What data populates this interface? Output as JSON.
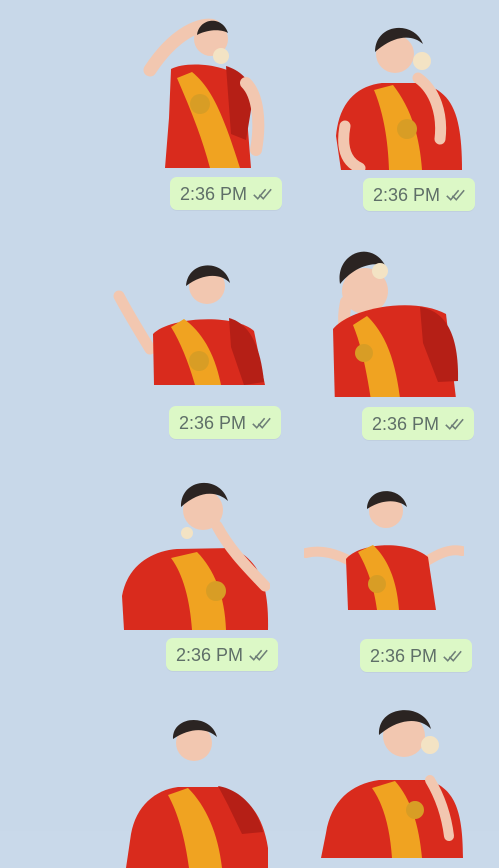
{
  "messages": [
    {
      "time": "2:36 PM",
      "sticker": "woman-hand-on-forehead-sticker",
      "status_icon": "double-check-icon"
    },
    {
      "time": "2:36 PM",
      "sticker": "woman-thinking-hand-on-neck-sticker",
      "status_icon": "double-check-icon"
    },
    {
      "time": "2:36 PM",
      "sticker": "woman-laughing-gesture-sticker",
      "status_icon": "double-check-icon"
    },
    {
      "time": "2:36 PM",
      "sticker": "woman-covering-face-laughing-sticker",
      "status_icon": "double-check-icon"
    },
    {
      "time": "2:36 PM",
      "sticker": "woman-shocked-hand-on-mouth-sticker",
      "status_icon": "double-check-icon"
    },
    {
      "time": "2:36 PM",
      "sticker": "woman-shrugging-sticker",
      "status_icon": "double-check-icon"
    },
    {
      "time": "",
      "sticker": "woman-closed-eyes-sticker",
      "status_icon": ""
    },
    {
      "time": "",
      "sticker": "woman-side-look-sticker",
      "status_icon": ""
    }
  ],
  "colors": {
    "background": "#c8d8e9",
    "bubble": "#dcf8c6",
    "text": "#5f6f68",
    "saree_red": "#d92b1d",
    "saree_gold": "#f0a321",
    "skin": "#f2c7b0",
    "hair": "#2b2422"
  }
}
